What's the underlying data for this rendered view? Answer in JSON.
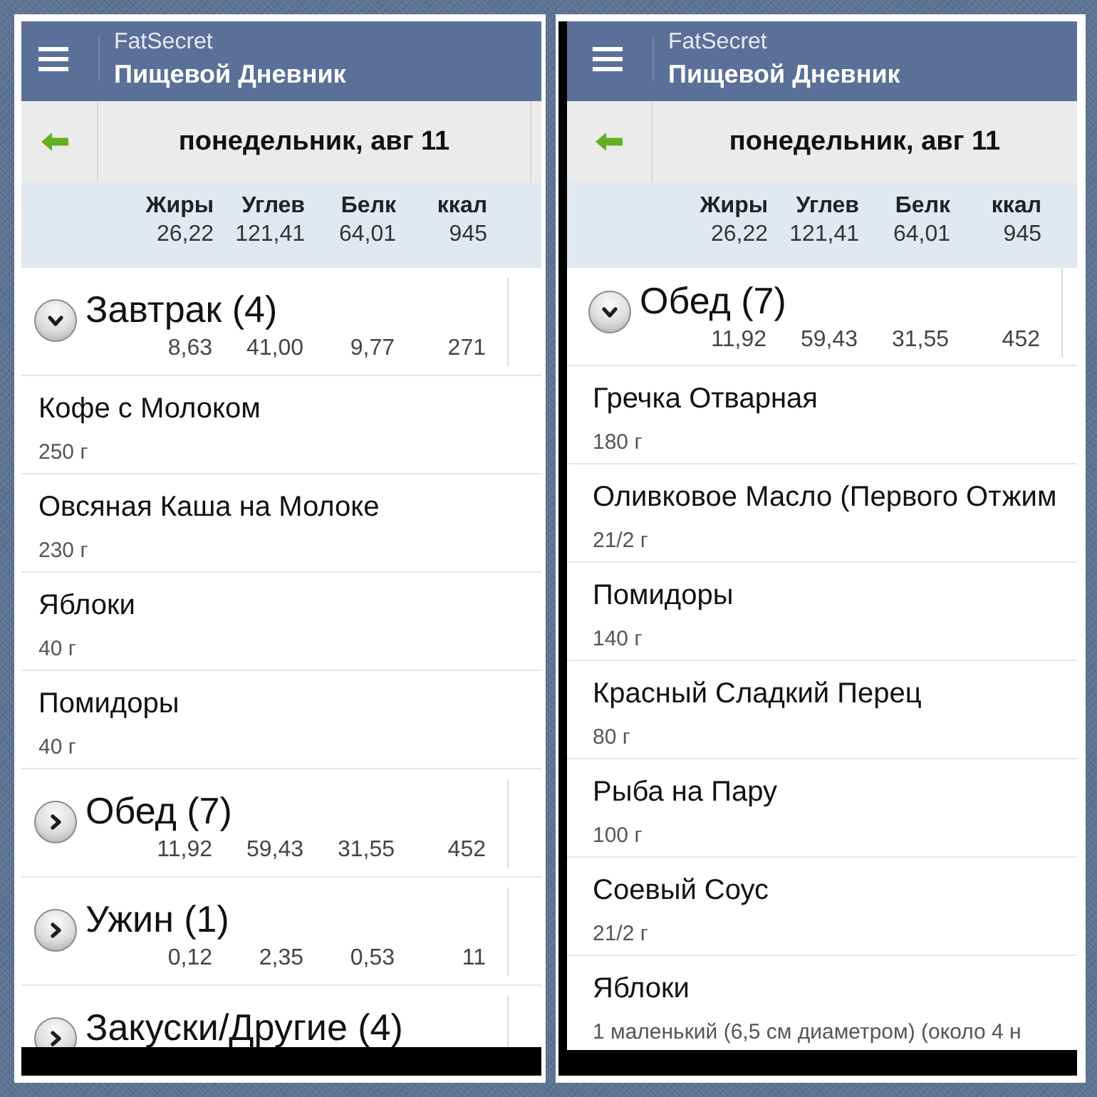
{
  "screens": [
    {
      "header": {
        "brand": "FatSecret",
        "title": "Пищевой Дневник"
      },
      "date": "понедельник, авг 11",
      "totals": {
        "labels": [
          "Жиры",
          "Углев",
          "Белк",
          "ккал"
        ],
        "values": [
          "26,22",
          "121,41",
          "64,01",
          "945"
        ]
      },
      "meals": [
        {
          "title": "Завтрак (4)",
          "expanded": true,
          "values": [
            "8,63",
            "41,00",
            "9,77",
            "271"
          ],
          "items": [
            {
              "name": "Кофе с Молоком",
              "amount": "250 г"
            },
            {
              "name": "Овсяная Каша на Молоке",
              "amount": "230 г"
            },
            {
              "name": "Яблоки",
              "amount": "40 г"
            },
            {
              "name": "Помидоры",
              "amount": "40 г"
            }
          ]
        },
        {
          "title": "Обед (7)",
          "expanded": false,
          "values": [
            "11,92",
            "59,43",
            "31,55",
            "452"
          ]
        },
        {
          "title": "Ужин (1)",
          "expanded": false,
          "values": [
            "0,12",
            "2,35",
            "0,53",
            "11"
          ]
        },
        {
          "title": "Закуски/Другие (4)",
          "expanded": false
        }
      ]
    },
    {
      "header": {
        "brand": "FatSecret",
        "title": "Пищевой Дневник"
      },
      "date": "понедельник, авг 11",
      "totals": {
        "labels": [
          "Жиры",
          "Углев",
          "Белк",
          "ккал"
        ],
        "values": [
          "26,22",
          "121,41",
          "64,01",
          "945"
        ]
      },
      "meals": [
        {
          "title": "Обед (7)",
          "expanded": true,
          "values": [
            "11,92",
            "59,43",
            "31,55",
            "452"
          ],
          "items": [
            {
              "name": "Гречка Отварная",
              "amount": "180 г"
            },
            {
              "name": "Оливковое Масло (Первого Отжим",
              "amount": "21/2 г"
            },
            {
              "name": "Помидоры",
              "amount": "140 г"
            },
            {
              "name": "Красный Сладкий Перец",
              "amount": "80 г"
            },
            {
              "name": "Рыба на Пару",
              "amount": "100 г"
            },
            {
              "name": "Соевый Соус",
              "amount": "21/2 г"
            },
            {
              "name": "Яблоки",
              "amount": "1 маленький (6,5 см диаметром) (около 4 н"
            }
          ]
        }
      ]
    }
  ]
}
